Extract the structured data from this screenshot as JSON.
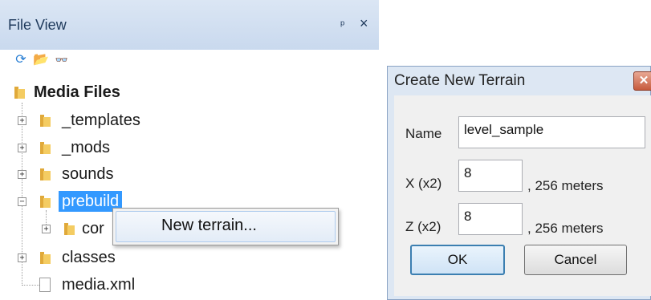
{
  "file_view": {
    "title": "File View",
    "pin": "ᵖ",
    "close": "×",
    "toolbar": {
      "refresh": "⟳",
      "open_folder": "📂",
      "find": "👓"
    },
    "tree": {
      "root": "Media Files",
      "items": [
        "_templates",
        "_mods",
        "sounds",
        "prebuild",
        "cor",
        "classes",
        "media.xml"
      ]
    },
    "context_menu": {
      "item": "New terrain..."
    }
  },
  "dialog": {
    "title": "Create New Terrain",
    "close": "✕",
    "name_label": "Name",
    "name_value": "level_sample",
    "x_label": "X (x2)",
    "x_value": "8",
    "x_suffix": ", 256 meters",
    "z_label": "Z (x2)",
    "z_value": "8",
    "z_suffix": ", 256 meters",
    "ok": "OK",
    "cancel": "Cancel"
  },
  "colors": {
    "header_bg": "#c9d9ee",
    "selection": "#3399ff",
    "folder": "#f4cc62",
    "dialog_bg": "#dde7f3"
  }
}
